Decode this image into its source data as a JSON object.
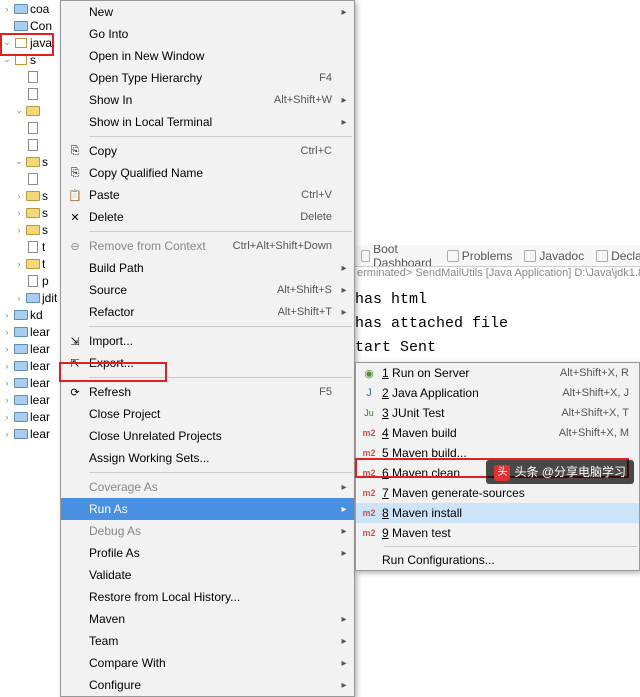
{
  "tree": {
    "items": [
      {
        "twist": "›",
        "icon": "folder-blue",
        "label": "coa"
      },
      {
        "twist": "",
        "icon": "folder-blue",
        "label": "Con"
      },
      {
        "twist": "v",
        "icon": "pkg",
        "label": "java"
      },
      {
        "twist": "v",
        "icon": "pkg",
        "label": "s"
      },
      {
        "twist": "",
        "icon": "file",
        "label": ""
      },
      {
        "twist": "",
        "icon": "file",
        "label": ""
      },
      {
        "twist": "v",
        "icon": "folder",
        "label": ""
      },
      {
        "twist": "",
        "icon": "file",
        "label": ""
      },
      {
        "twist": "",
        "icon": "file",
        "label": ""
      },
      {
        "twist": "v",
        "icon": "folder",
        "label": "s"
      },
      {
        "twist": "",
        "icon": "file",
        "label": ""
      },
      {
        "twist": "›",
        "icon": "folder",
        "label": "s"
      },
      {
        "twist": "›",
        "icon": "folder",
        "label": "s"
      },
      {
        "twist": "›",
        "icon": "folder",
        "label": "s"
      },
      {
        "twist": "",
        "icon": "file",
        "label": "t"
      },
      {
        "twist": "›",
        "icon": "folder",
        "label": "t"
      },
      {
        "twist": "",
        "icon": "file",
        "label": "p"
      },
      {
        "twist": "›",
        "icon": "folder-blue",
        "label": "jdit"
      },
      {
        "twist": "›",
        "icon": "folder-blue",
        "label": "kd"
      },
      {
        "twist": "›",
        "icon": "folder-blue",
        "label": "lear"
      },
      {
        "twist": "›",
        "icon": "folder-blue",
        "label": "lear"
      },
      {
        "twist": "›",
        "icon": "folder-blue",
        "label": "lear"
      },
      {
        "twist": "›",
        "icon": "folder-blue",
        "label": "lear"
      },
      {
        "twist": "›",
        "icon": "folder-blue",
        "label": "lear"
      },
      {
        "twist": "›",
        "icon": "folder-blue",
        "label": "lear"
      },
      {
        "twist": "›",
        "icon": "folder-blue",
        "label": "lear"
      }
    ]
  },
  "menu": [
    {
      "label": "New",
      "arrow": true
    },
    {
      "label": "Go Into"
    },
    {
      "label": "Open in New Window"
    },
    {
      "label": "Open Type Hierarchy",
      "accel": "F4"
    },
    {
      "label": "Show In",
      "accel": "Alt+Shift+W",
      "arrow": true
    },
    {
      "label": "Show in Local Terminal",
      "arrow": true
    },
    {
      "sep": true
    },
    {
      "label": "Copy",
      "accel": "Ctrl+C",
      "icon": "copy"
    },
    {
      "label": "Copy Qualified Name",
      "icon": "copyq"
    },
    {
      "label": "Paste",
      "accel": "Ctrl+V",
      "icon": "paste"
    },
    {
      "label": "Delete",
      "accel": "Delete",
      "icon": "delete"
    },
    {
      "sep": true
    },
    {
      "label": "Remove from Context",
      "accel": "Ctrl+Alt+Shift+Down",
      "disabled": true,
      "icon": "remove"
    },
    {
      "label": "Build Path",
      "arrow": true
    },
    {
      "label": "Source",
      "accel": "Alt+Shift+S",
      "arrow": true
    },
    {
      "label": "Refactor",
      "accel": "Alt+Shift+T",
      "arrow": true
    },
    {
      "sep": true
    },
    {
      "label": "Import...",
      "icon": "import"
    },
    {
      "label": "Export...",
      "icon": "export"
    },
    {
      "sep": true
    },
    {
      "label": "Refresh",
      "accel": "F5",
      "icon": "refresh"
    },
    {
      "label": "Close Project"
    },
    {
      "label": "Close Unrelated Projects"
    },
    {
      "label": "Assign Working Sets..."
    },
    {
      "sep": true
    },
    {
      "label": "Coverage As",
      "arrow": true,
      "disabled": true
    },
    {
      "label": "Run As",
      "arrow": true,
      "hl": true
    },
    {
      "label": "Debug As",
      "arrow": true,
      "disabled": true
    },
    {
      "label": "Profile As",
      "arrow": true
    },
    {
      "label": "Validate"
    },
    {
      "label": "Restore from Local History..."
    },
    {
      "label": "Maven",
      "arrow": true
    },
    {
      "label": "Team",
      "arrow": true
    },
    {
      "label": "Compare With",
      "arrow": true
    },
    {
      "label": "Configure",
      "arrow": true
    }
  ],
  "submenu": [
    {
      "hot": "1",
      "label": " Run on Server",
      "accel": "Alt+Shift+X, R",
      "icon": "server"
    },
    {
      "hot": "2",
      "label": " Java Application",
      "accel": "Alt+Shift+X, J",
      "icon": "java"
    },
    {
      "hot": "3",
      "label": " JUnit Test",
      "accel": "Alt+Shift+X, T",
      "icon": "junit"
    },
    {
      "hot": "4",
      "label": " Maven build",
      "accel": "Alt+Shift+X, M",
      "icon": "m2"
    },
    {
      "hot": "5",
      "label": " Maven build...",
      "icon": "m2"
    },
    {
      "hot": "6",
      "label": " Maven clean",
      "icon": "m2"
    },
    {
      "hot": "7",
      "label": " Maven generate-sources",
      "icon": "m2"
    },
    {
      "hot": "8",
      "label": " Maven install",
      "icon": "m2",
      "hl": true
    },
    {
      "hot": "9",
      "label": " Maven test",
      "icon": "m2"
    },
    {
      "sep": true
    },
    {
      "label": "Run Configurations..."
    }
  ],
  "bgTabs": [
    "Boot Dashboard",
    "Problems",
    "Javadoc",
    "Declaration"
  ],
  "console": {
    "header": "erminated> SendMailUtils [Java Application] D:\\Java\\jdk1.8",
    "lines": [
      "has html",
      "has attached file",
      "tart Sent"
    ]
  },
  "watermark": "头条 @分享电脑学习"
}
